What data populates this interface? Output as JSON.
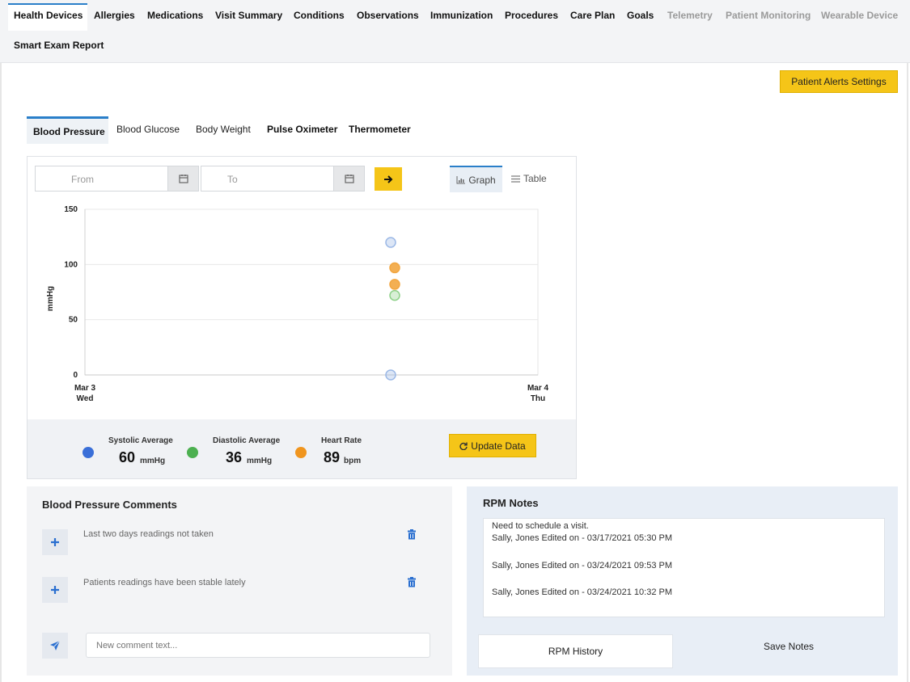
{
  "top_tabs": [
    {
      "label": "Health Devices"
    },
    {
      "label": "Allergies"
    },
    {
      "label": "Medications"
    },
    {
      "label": "Visit Summary"
    },
    {
      "label": "Conditions"
    },
    {
      "label": "Observations"
    },
    {
      "label": "Immunization"
    },
    {
      "label": "Procedures"
    },
    {
      "label": "Care Plan"
    },
    {
      "label": "Goals"
    },
    {
      "label": "Telemetry"
    },
    {
      "label": "Patient Monitoring"
    },
    {
      "label": "Wearable Device"
    },
    {
      "label": "Smart Exam Report"
    }
  ],
  "alerts_button": "Patient Alerts Settings",
  "device_tabs": [
    {
      "label": "Blood Pressure"
    },
    {
      "label": "Blood Glucose"
    },
    {
      "label": "Body Weight"
    },
    {
      "label": "Pulse Oximeter"
    },
    {
      "label": "Thermometer"
    }
  ],
  "filters": {
    "from_placeholder": "From",
    "to_placeholder": "To"
  },
  "view_toggle": {
    "graph": "Graph",
    "table": "Table"
  },
  "chart_data": {
    "type": "scatter",
    "ylabel": "mmHg",
    "ylim": [
      0,
      150
    ],
    "yticks": [
      "150",
      "100",
      "50",
      "0"
    ],
    "xticks": [
      {
        "line1": "Mar 3",
        "line2": "Wed"
      },
      {
        "line1": "Mar 4",
        "line2": "Thu"
      }
    ],
    "grid": true,
    "series": [
      {
        "color": "#9bb8e6",
        "points": [
          {
            "x": "Mar 3 ~17:00",
            "y": 120
          },
          {
            "x": "Mar 3 ~17:00",
            "y": 0
          }
        ]
      },
      {
        "color": "#f2a640",
        "points": [
          {
            "x": "Mar 3 ~17:00",
            "y": 97
          },
          {
            "x": "Mar 3 ~17:00",
            "y": 82
          }
        ]
      },
      {
        "color": "#8fd18a",
        "points": [
          {
            "x": "Mar 3 ~17:00",
            "y": 72
          }
        ]
      }
    ]
  },
  "summary": {
    "systolic": {
      "label": "Systolic Average",
      "value": "60",
      "unit": "mmHg",
      "color": "#3a6fd8"
    },
    "diastolic": {
      "label": "Diastolic Average",
      "value": "36",
      "unit": "mmHg",
      "color": "#4cb050"
    },
    "heart_rate": {
      "label": "Heart Rate",
      "value": "89",
      "unit": "bpm",
      "color": "#f0951e"
    }
  },
  "update_button": "Update Data",
  "comments": {
    "title": "Blood Pressure Comments",
    "items": [
      {
        "text": "Last two days readings not taken"
      },
      {
        "text": "Patients readings have been stable lately"
      }
    ],
    "new_placeholder": "New comment text..."
  },
  "rpm": {
    "title": "RPM Notes",
    "lines": [
      "Need to schedule a visit.",
      "Sally, Jones Edited on - 03/17/2021 05:30 PM",
      "Sally, Jones Edited on - 03/24/2021 09:53 PM",
      "Sally, Jones Edited on - 03/24/2021 10:32 PM"
    ],
    "history_button": "RPM History",
    "save_button": "Save Notes"
  }
}
